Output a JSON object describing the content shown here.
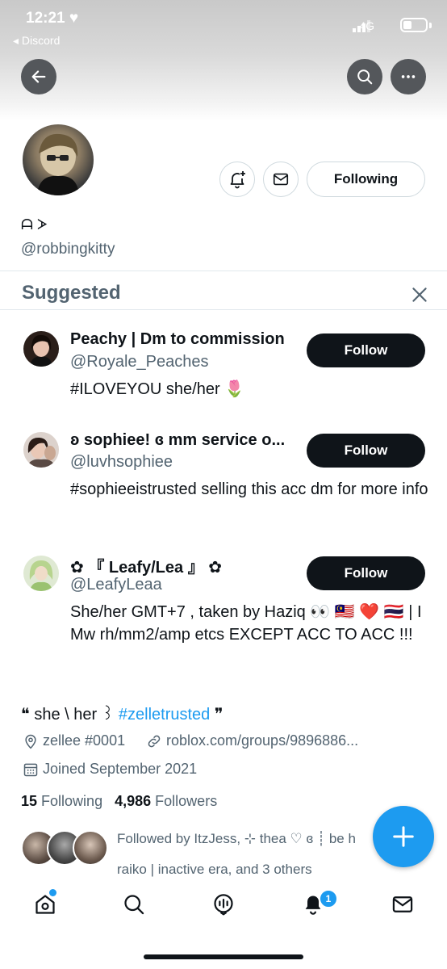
{
  "status_bar": {
    "time": "12:21 ♥",
    "back_app": "◂ Discord",
    "network": "4G"
  },
  "profile": {
    "display_name": "ᗩ ᗆ",
    "handle": "@robbingkitty",
    "following_button": "Following",
    "bio_start": "❝ she \\ her ꒱ ",
    "bio_link": "#zelletrusted",
    "bio_end": " ❞",
    "location": "zellee #0001",
    "website": "roblox.com/groups/9896886...",
    "joined": "Joined September 2021",
    "following_count": "15",
    "following_label": "Following",
    "followers_count": "4,986",
    "followers_label": "Followers",
    "followed_by_line1": "Followed by ItzJess, ⊹ thea ♡ ɞ ┊ be h",
    "followed_by_line2": "raiko | inactive era, and 3 others"
  },
  "suggested": {
    "title": "Suggested",
    "items": [
      {
        "name": "Peachy | Dm to commission",
        "handle": "@Royale_Peaches",
        "bio": "#ILOVEYOU she/her 🌷",
        "button": "Follow"
      },
      {
        "name": "ʚ sophiee! ɞ mm service o...",
        "handle": "@luvhsophiee",
        "bio": "#sophieeistrusted selling this acc dm for more info",
        "button": "Follow"
      },
      {
        "name": "✿ 『 Leafy/Lea 』 ✿",
        "handle": "@LeafyLeaa",
        "bio": "She/her GMT+7 , taken by Haziq 👀 🇲🇾 ❤️ 🇹🇭 | I Mw rh/mm2/amp etcs EXCEPT ACC TO ACC !!!",
        "button": "Follow"
      }
    ]
  },
  "tabbar": {
    "notification_badge": "1"
  },
  "colors": {
    "accent": "#1d9bf0",
    "text": "#0f1419",
    "muted": "#536471",
    "border": "#cfd9de"
  },
  "icons": [
    "back-arrow-icon",
    "search-icon",
    "more-icon",
    "notification-add-icon",
    "mail-icon",
    "close-icon",
    "location-icon",
    "link-icon",
    "calendar-icon",
    "compose-icon",
    "home-icon",
    "spaces-icon",
    "bell-icon"
  ]
}
